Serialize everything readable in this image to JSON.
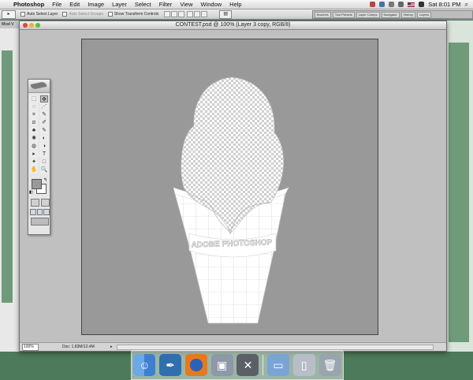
{
  "menubar": {
    "app": "Photoshop",
    "items": [
      "File",
      "Edit",
      "Image",
      "Layer",
      "Select",
      "Filter",
      "View",
      "Window",
      "Help"
    ],
    "clock": "Sat 8:01 PM"
  },
  "options": {
    "auto_select_layer": "Auto Select Layer",
    "auto_select_groups": "Auto Select Groups",
    "show_transform_controls": "Show Transform Controls",
    "palette_well_tabs": [
      "Brushes",
      "Tool Presets",
      "Layer Comps",
      "Navigator",
      "History",
      "Layers"
    ]
  },
  "background_window": {
    "left_title": "Most V"
  },
  "document": {
    "title": "CONTEST.psd @ 100% (Layer 3 copy, RGB/8)",
    "zoom": "100%",
    "doc_size": "Doc: 1.83M/12.4M",
    "cone_text": "ADOBE PHOTOSHOP"
  },
  "tools": {
    "glyphs": [
      "⬚",
      "✥",
      "◌",
      "⋰",
      "⌗",
      "✎",
      "⧄",
      "✐",
      "♣",
      "✎",
      "✺",
      "◐",
      "◍",
      "◑",
      "▸",
      "T",
      "✦",
      "□",
      "✋",
      "🔍"
    ]
  },
  "dock": {
    "items": [
      "finder-icon",
      "feather-icon",
      "firefox-icon",
      "preview-icon",
      "terminal-icon",
      "folder-icon",
      "document-icon",
      "trash-icon"
    ]
  }
}
